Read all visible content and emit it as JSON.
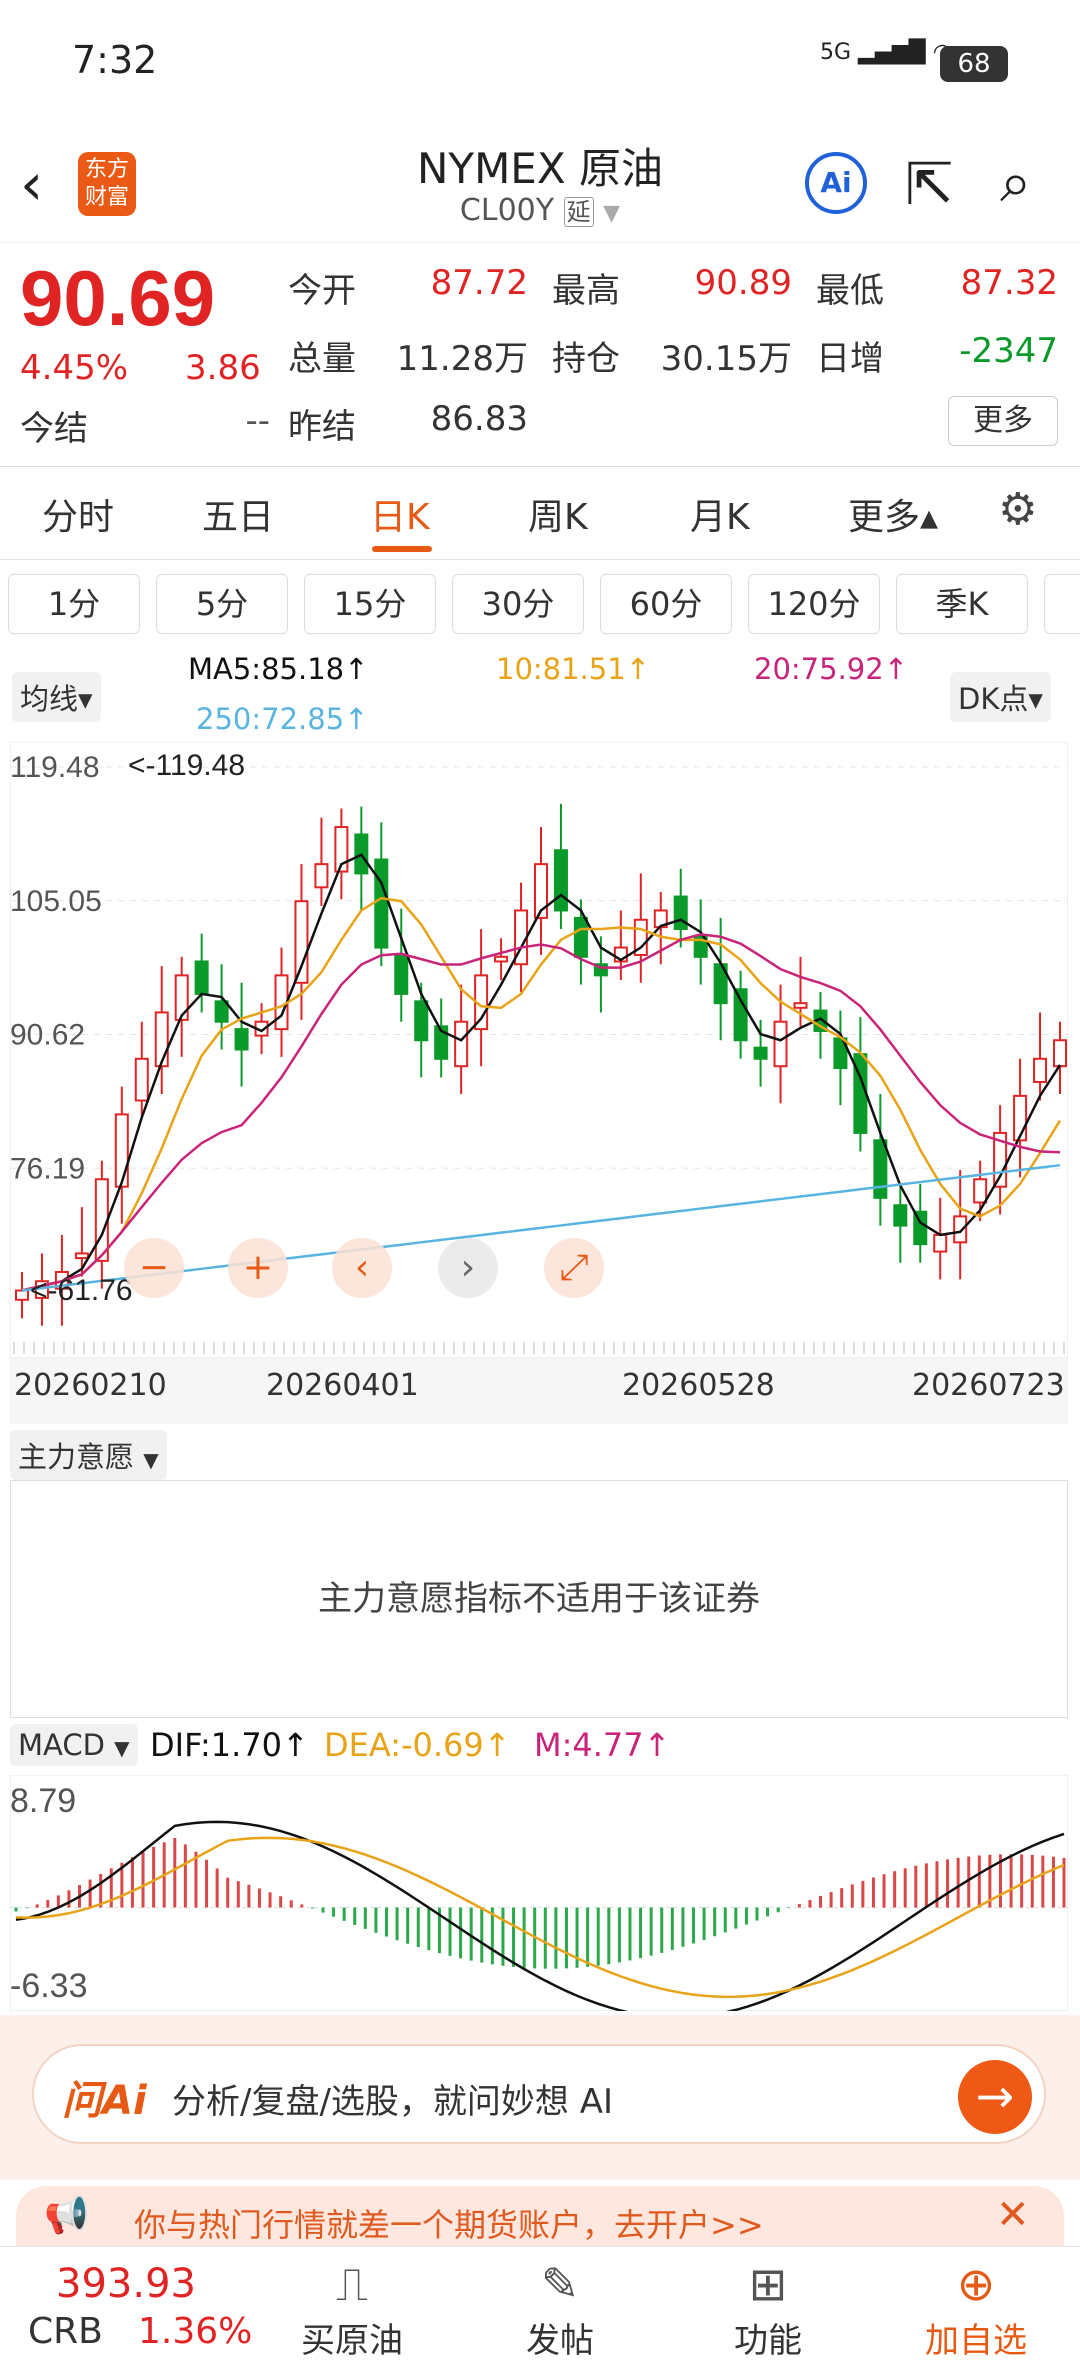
{
  "status_bar": {
    "time": "7:32",
    "signal": "5G",
    "battery": "68"
  },
  "header": {
    "back_icon": "chevron-left-icon",
    "logo_text": "东方财富",
    "title": "NYMEX 原油",
    "subtitle": "CL00Y",
    "delay_badge": "延",
    "ai_label": "Ai"
  },
  "quote": {
    "price": "90.69",
    "change_pct": "4.45%",
    "change": "3.86",
    "settle_label": "今结",
    "settle_value": "--",
    "fields": [
      {
        "label": "今开",
        "value": "87.72",
        "color": "red"
      },
      {
        "label": "最高",
        "value": "90.89",
        "color": "red"
      },
      {
        "label": "最低",
        "value": "87.32",
        "color": "red"
      },
      {
        "label": "总量",
        "value": "11.28万",
        "color": "dark"
      },
      {
        "label": "持仓",
        "value": "30.15万",
        "color": "dark"
      },
      {
        "label": "日增",
        "value": "-2347",
        "color": "green"
      },
      {
        "label": "昨结",
        "value": "86.83",
        "color": "dark"
      }
    ],
    "more_label": "更多"
  },
  "tabs": [
    "分时",
    "五日",
    "日K",
    "周K",
    "月K",
    "更多▴"
  ],
  "active_tab": "日K",
  "minute_buttons": [
    "1分",
    "5分",
    "15分",
    "30分",
    "60分",
    "120分",
    "季K"
  ],
  "ma": {
    "selector": "均线▾",
    "ma5": "MA5:85.18↑",
    "ma10": "10:81.51↑",
    "ma20": "20:75.92↑",
    "ma250": "250:72.85↑",
    "dk_label": "DK点▾",
    "colors": {
      "ma5": "#111111",
      "ma10": "#e8a317",
      "ma20": "#c8247a",
      "ma250": "#5ab4e0"
    }
  },
  "chart_data": {
    "type": "candlestick",
    "y_ticks": [
      "119.48",
      "105.05",
      "90.62",
      "76.19"
    ],
    "y_bottom_label": "61.76",
    "annotations": {
      "high": "<-119.48",
      "low": "<-61.76"
    },
    "x_ticks": [
      "20260210",
      "20260401",
      "20260528",
      "20260723"
    ],
    "ylim": [
      61.76,
      119.48
    ],
    "closes": [
      63,
      64,
      65,
      67,
      75,
      82,
      88,
      93,
      97,
      95,
      92,
      89,
      92,
      97,
      105,
      109,
      113,
      108,
      100,
      95,
      90,
      88,
      92,
      97,
      99,
      104,
      109,
      104,
      99,
      97,
      100,
      103,
      104,
      102,
      99,
      94,
      90,
      88,
      92,
      94,
      91,
      87,
      80,
      73,
      70,
      68,
      69,
      71,
      75,
      80,
      84,
      88,
      90
    ],
    "colors": {
      "up": "#e02424",
      "down": "#0a9a2a"
    }
  },
  "main_force": {
    "label": "主力意愿",
    "message": "主力意愿指标不适用于该证券"
  },
  "macd": {
    "selector": "MACD",
    "dif": "DIF:1.70↑",
    "dea": "DEA:-0.69↑",
    "m": "M:4.77↑",
    "y_ticks": [
      "8.79",
      "-6.33"
    ],
    "ylim": [
      -6.33,
      8.79
    ],
    "colors": {
      "dif": "#111111",
      "dea": "#e8a317",
      "m": "#c8247a"
    }
  },
  "ai_bar": {
    "logo": "问Ai",
    "text": "分析/复盘/选股，就问妙想 AI",
    "go_icon": "arrow-right-icon"
  },
  "promo": {
    "icon": "megaphone-icon",
    "text": "你与热门行情就差一个期货账户，去开户>>",
    "close_icon": "close-icon"
  },
  "bottom_nav": {
    "ticker_value": "393.93",
    "ticker_name": "CRB",
    "ticker_change": "1.36%",
    "items": [
      {
        "label": "买原油",
        "icon": "chart-buy-icon"
      },
      {
        "label": "发帖",
        "icon": "edit-icon"
      },
      {
        "label": "功能",
        "icon": "grid-icon"
      },
      {
        "label": "加自选",
        "icon": "plus-circle-icon"
      }
    ]
  }
}
